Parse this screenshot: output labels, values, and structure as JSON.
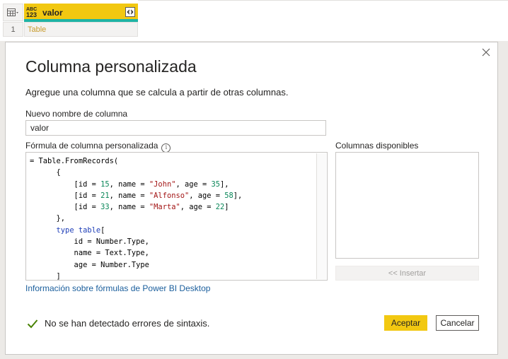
{
  "preview": {
    "column": {
      "type_icon": {
        "top": "ABC",
        "bottom": "123"
      },
      "name": "valor"
    },
    "row_number": "1",
    "cell_value": "Table"
  },
  "dialog": {
    "title": "Columna personalizada",
    "subtitle": "Agregue una columna que se calcula a partir de otras columnas.",
    "name_label": "Nuevo nombre de columna",
    "name_value": "valor",
    "formula_label": "Fórmula de columna personalizada",
    "available_label": "Columnas disponibles",
    "insert_label": "<< Insertar",
    "help_link": "Información sobre fórmulas de Power BI Desktop",
    "status_text": "No se han detectado errores de sintaxis.",
    "ok_label": "Aceptar",
    "cancel_label": "Cancelar",
    "formula_lines": [
      "= Table.FromRecords(",
      "      {",
      "          [id = 15, name = \"John\", age = 35],",
      "          [id = 21, name = \"Alfonso\", age = 58],",
      "          [id = 33, name = \"Marta\", age = 22]",
      "      },",
      "      type table[",
      "          id = Number.Type,",
      "          name = Text.Type,",
      "          age = Number.Type",
      "      ]"
    ]
  },
  "colors": {
    "accent": "#f2c811",
    "quality_bar": "#1fb3a4",
    "link": "#1a5e9c",
    "status_check": "#498205"
  }
}
